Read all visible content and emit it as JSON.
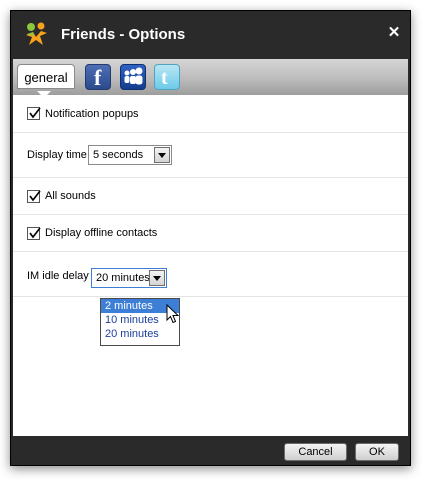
{
  "window": {
    "title": "Friends - Options",
    "close_label": "✕"
  },
  "tabs": [
    {
      "label": "general",
      "icon": "general-tab",
      "active": true
    },
    {
      "icon": "facebook-icon",
      "glyph": "f"
    },
    {
      "icon": "myspace-icon"
    },
    {
      "icon": "twitter-icon",
      "glyph": "t"
    }
  ],
  "settings": {
    "notification_popups": {
      "label": "Notification popups",
      "checked": true
    },
    "display_time": {
      "label": "Display time",
      "value": "5 seconds"
    },
    "all_sounds": {
      "label": "All sounds",
      "checked": true
    },
    "display_offline": {
      "label": "Display offline contacts",
      "checked": true
    },
    "im_idle_delay": {
      "label": "IM idle delay",
      "value": "20 minutes",
      "options": [
        "2 minutes",
        "10 minutes",
        "20 minutes"
      ],
      "highlighted_option": "2 minutes"
    }
  },
  "footer": {
    "cancel_label": "Cancel",
    "ok_label": "OK"
  },
  "colors": {
    "title_bar": "#2a2a2a",
    "selected_option": "#3d7ed6",
    "facebook": "#3b5998",
    "myspace": "#1f4fa8",
    "twitter": "#8fd3ee"
  }
}
